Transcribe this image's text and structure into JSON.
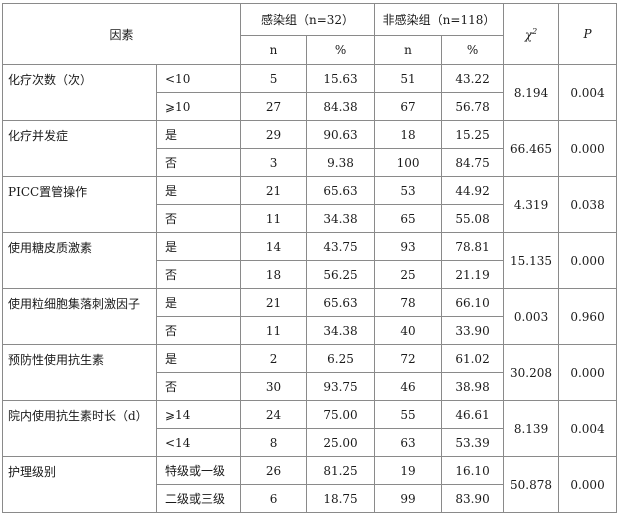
{
  "header": {
    "factor": "因素",
    "group_infected": "感染组（n=32）",
    "group_uninfected": "非感染组（n=118）",
    "chi_symbol": "χ",
    "chi_sup": "2",
    "p_label": "P",
    "n_label": "n",
    "pct_label": "%"
  },
  "rows": [
    {
      "factor": "化疗次数（次）",
      "chi2": "8.194",
      "p": "0.004",
      "levels": [
        {
          "label": "<10",
          "inf_n": "5",
          "inf_pct": "15.63",
          "uninf_n": "51",
          "uninf_pct": "43.22"
        },
        {
          "label": "⩾10",
          "inf_n": "27",
          "inf_pct": "84.38",
          "uninf_n": "67",
          "uninf_pct": "56.78"
        }
      ]
    },
    {
      "factor": "化疗并发症",
      "chi2": "66.465",
      "p": "0.000",
      "levels": [
        {
          "label": "是",
          "inf_n": "29",
          "inf_pct": "90.63",
          "uninf_n": "18",
          "uninf_pct": "15.25"
        },
        {
          "label": "否",
          "inf_n": "3",
          "inf_pct": "9.38",
          "uninf_n": "100",
          "uninf_pct": "84.75"
        }
      ]
    },
    {
      "factor": "PICC置管操作",
      "chi2": "4.319",
      "p": "0.038",
      "levels": [
        {
          "label": "是",
          "inf_n": "21",
          "inf_pct": "65.63",
          "uninf_n": "53",
          "uninf_pct": "44.92"
        },
        {
          "label": "否",
          "inf_n": "11",
          "inf_pct": "34.38",
          "uninf_n": "65",
          "uninf_pct": "55.08"
        }
      ]
    },
    {
      "factor": "使用糖皮质激素",
      "chi2": "15.135",
      "p": "0.000",
      "levels": [
        {
          "label": "是",
          "inf_n": "14",
          "inf_pct": "43.75",
          "uninf_n": "93",
          "uninf_pct": "78.81"
        },
        {
          "label": "否",
          "inf_n": "18",
          "inf_pct": "56.25",
          "uninf_n": "25",
          "uninf_pct": "21.19"
        }
      ]
    },
    {
      "factor": "使用粒细胞集落刺激因子",
      "chi2": "0.003",
      "p": "0.960",
      "levels": [
        {
          "label": "是",
          "inf_n": "21",
          "inf_pct": "65.63",
          "uninf_n": "78",
          "uninf_pct": "66.10"
        },
        {
          "label": "否",
          "inf_n": "11",
          "inf_pct": "34.38",
          "uninf_n": "40",
          "uninf_pct": "33.90"
        }
      ]
    },
    {
      "factor": "预防性使用抗生素",
      "chi2": "30.208",
      "p": "0.000",
      "levels": [
        {
          "label": "是",
          "inf_n": "2",
          "inf_pct": "6.25",
          "uninf_n": "72",
          "uninf_pct": "61.02"
        },
        {
          "label": "否",
          "inf_n": "30",
          "inf_pct": "93.75",
          "uninf_n": "46",
          "uninf_pct": "38.98"
        }
      ]
    },
    {
      "factor": "院内使用抗生素时长（d）",
      "chi2": "8.139",
      "p": "0.004",
      "levels": [
        {
          "label": "⩾14",
          "inf_n": "24",
          "inf_pct": "75.00",
          "uninf_n": "55",
          "uninf_pct": "46.61"
        },
        {
          "label": "<14",
          "inf_n": "8",
          "inf_pct": "25.00",
          "uninf_n": "63",
          "uninf_pct": "53.39"
        }
      ]
    },
    {
      "factor": "护理级别",
      "chi2": "50.878",
      "p": "0.000",
      "levels": [
        {
          "label": "特级或一级",
          "inf_n": "26",
          "inf_pct": "81.25",
          "uninf_n": "19",
          "uninf_pct": "16.10"
        },
        {
          "label": "二级或三级",
          "inf_n": "6",
          "inf_pct": "18.75",
          "uninf_n": "99",
          "uninf_pct": "83.90"
        }
      ]
    }
  ]
}
